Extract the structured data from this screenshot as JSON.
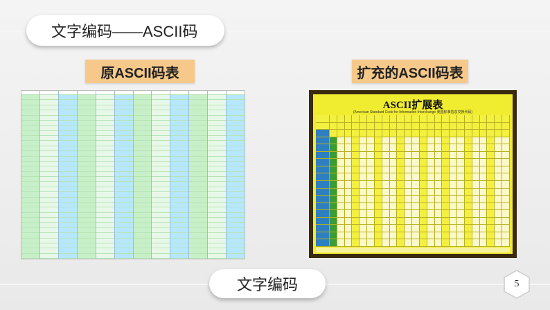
{
  "slide": {
    "title": "文字编码——ASCII码",
    "left_heading": "原ASCII码表",
    "right_heading": "扩充的ASCII码表",
    "right_table_title": "ASCII扩展表",
    "right_table_subtitle": "(American Standard Code for Information Interchange 美国标准信息交换代码)",
    "bottom_label": "文字编码",
    "page_number": "5"
  }
}
